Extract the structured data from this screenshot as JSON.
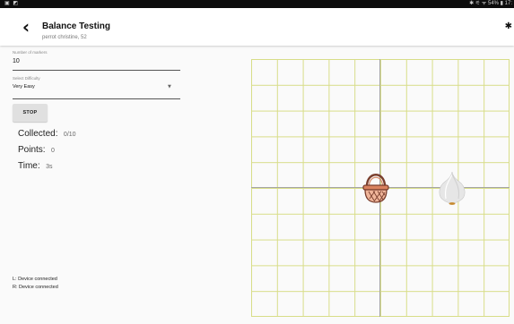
{
  "status_bar": {
    "left_icons": "▣ ◩",
    "right_text": "✱ ⚟ ᯤ 54% ▮ 17:"
  },
  "app_bar": {
    "back_icon": "arrow-back-icon",
    "title": "Balance Testing",
    "subtitle": "perrot christine, 52",
    "bluetooth_icon": "bluetooth-icon"
  },
  "form": {
    "markers_label": "Number of markers",
    "markers_value": "10",
    "difficulty_label": "Select Difficulty",
    "difficulty_value": "Very Easy",
    "stop_label": "STOP"
  },
  "stats": {
    "collected_label": "Collected:",
    "collected_value": "0/10",
    "points_label": "Points:",
    "points_value": "0",
    "time_label": "Time:",
    "time_value": "3s"
  },
  "devices": {
    "left": "L: Device connected",
    "right": "R: Device connected"
  },
  "game": {
    "grid_color": "#d8dd88",
    "axis_color": "#a4a4a4",
    "player_icon": "basket-icon",
    "target_icon": "garlic-icon"
  }
}
